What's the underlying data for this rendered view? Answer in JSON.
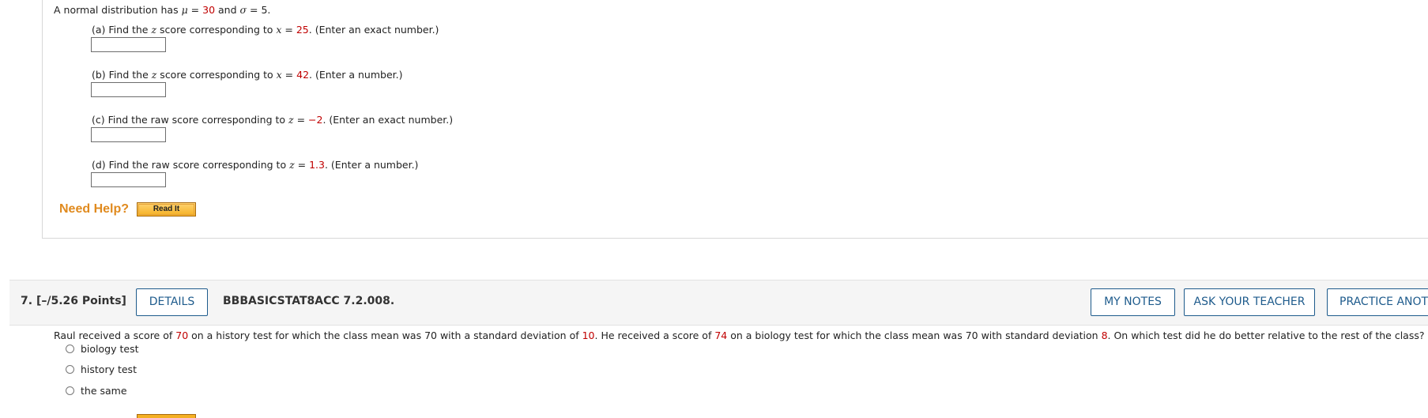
{
  "q6": {
    "intro": {
      "pre": "A normal distribution has ",
      "mu_sym": "μ",
      "eq1": " = ",
      "mu": "30",
      "and": " and ",
      "sigma_sym": "σ",
      "eq2": " = ",
      "sigma": "5",
      "end": "."
    },
    "parts": [
      {
        "pre": "(a) Find the ",
        "var1": "z",
        "mid": " score corresponding to ",
        "var2": "x",
        "eq": " = ",
        "val": "25",
        "post": ". (Enter an exact number.)"
      },
      {
        "pre": "(b) Find the ",
        "var1": "z",
        "mid": " score corresponding to ",
        "var2": "x",
        "eq": " = ",
        "val": "42",
        "post": ". (Enter a number.)"
      },
      {
        "pre": "(c) Find the raw score corresponding to ",
        "var2": "z",
        "eq": " = ",
        "val": "−2",
        "post": ". (Enter an exact number.)"
      },
      {
        "pre": "(d) Find the raw score corresponding to ",
        "var2": "z",
        "eq": " = ",
        "val": "1.3",
        "post": ". (Enter a number.)"
      }
    ],
    "answers": [
      "",
      "",
      "",
      ""
    ],
    "need_help": "Need Help?",
    "read_it": "Read It"
  },
  "q7": {
    "number": "7.",
    "points": "[–/5.26 Points]",
    "details": "DETAILS",
    "code": "BBBASICSTAT8ACC 7.2.008.",
    "my_notes": "MY NOTES",
    "ask_teacher": "ASK YOUR TEACHER",
    "practice": "PRACTICE ANOTHER",
    "question": {
      "s1": "Raul received a score of ",
      "v1": "70",
      "s2": " on a history test for which the class mean was 70 with a standard deviation of ",
      "v2": "10",
      "s3": ". He received a score of ",
      "v3": "74",
      "s4": " on a biology test for which the class mean was 70 with standard deviation ",
      "v4": "8",
      "s5": ". On which test did he do better relative to the rest of the class?"
    },
    "options": [
      "biology test",
      "history test",
      "the same"
    ]
  }
}
